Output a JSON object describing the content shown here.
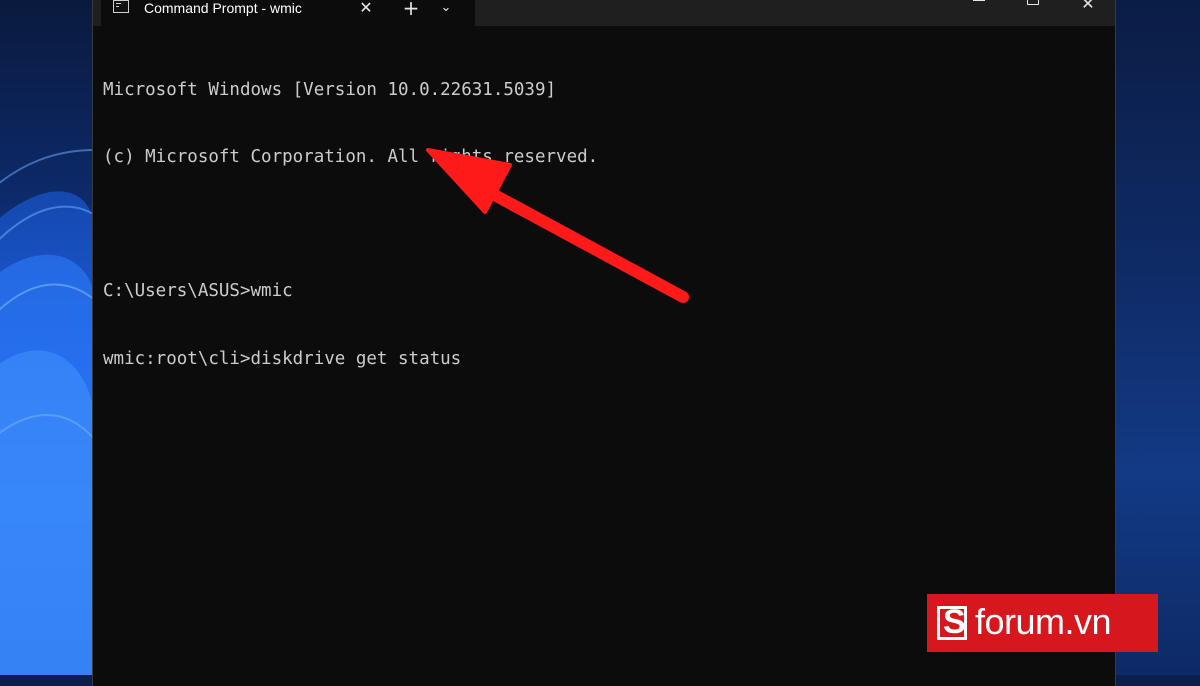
{
  "window": {
    "tab_title": "Command Prompt - wmic",
    "tab_close_symbol": "✕",
    "new_tab_symbol": "+",
    "dropdown_symbol": "⌄",
    "close_symbol": "✕",
    "icons": {
      "tab": "command-prompt-icon",
      "minimize": "minimize-icon",
      "maximize": "maximize-icon",
      "close": "close-icon"
    }
  },
  "console": {
    "lines": [
      "Microsoft Windows [Version 10.0.22631.5039]",
      "(c) Microsoft Corporation. All rights reserved.",
      "",
      "C:\\Users\\ASUS>wmic",
      "wmic:root\\cli>diskdrive get status"
    ]
  },
  "annotation": {
    "color": "#ff1a1a"
  },
  "watermark": {
    "text": "forum.vn",
    "brand_color": "#d6171e"
  },
  "colors": {
    "terminal_background": "#0c0c0c",
    "titlebar_background": "#1f1f1f",
    "console_text": "#cccccc"
  }
}
